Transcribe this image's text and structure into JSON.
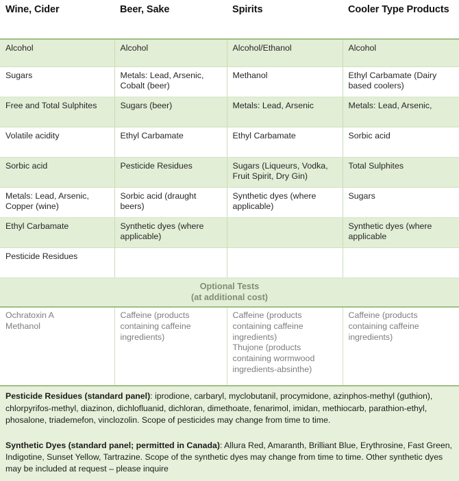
{
  "table": {
    "headers": [
      "Wine, Cider",
      "Beer, Sake",
      "Spirits",
      "Cooler Type Products"
    ],
    "rows": [
      [
        "Alcohol",
        "Alcohol",
        "Alcohol/Ethanol",
        "Alcohol"
      ],
      [
        "Sugars",
        "Metals: Lead, Arsenic, Cobalt (beer)",
        "Methanol",
        "Ethyl Carbamate (Dairy based coolers)"
      ],
      [
        "Free and Total Sulphites",
        "Sugars (beer)",
        "Metals: Lead, Arsenic",
        "Metals: Lead, Arsenic,"
      ],
      [
        "Volatile acidity",
        "Ethyl Carbamate",
        "Ethyl Carbamate",
        "Sorbic acid"
      ],
      [
        "Sorbic acid",
        "Pesticide Residues",
        "Sugars (Liqueurs, Vodka, Fruit Spirit, Dry Gin)",
        "Total Sulphites"
      ],
      [
        "Metals: Lead, Arsenic, Copper (wine)",
        "Sorbic acid (draught beers)",
        "Synthetic dyes (where applicable)",
        "Sugars"
      ],
      [
        "Ethyl Carbamate",
        "Synthetic dyes (where applicable)",
        "",
        "Synthetic dyes (where applicable"
      ],
      [
        "Pesticide Residues",
        "",
        "",
        ""
      ]
    ]
  },
  "optional": {
    "banner_line1": "Optional Tests",
    "banner_line2": "(at additional cost)",
    "cells": [
      "Ochratoxin A\nMethanol",
      "Caffeine (products containing caffeine ingredients)",
      "Caffeine (products containing caffeine ingredients)\nThujone (products containing wormwood ingredients-absinthe)",
      "Caffeine (products containing caffeine ingredients)"
    ]
  },
  "notes": [
    {
      "label": "Pesticide Residues (standard panel)",
      "text": ": iprodione, carbaryl, myclobutanil, procymidone, azinphos-methyl (guthion), chlorpyrifos-methyl, diazinon, dichlofluanid, dichloran, dimethoate, fenarimol, imidan, methiocarb, parathion-ethyl, phosalone, triademefon, vinclozolin. Scope of pesticides may change from time to time."
    },
    {
      "label": "Synthetic Dyes (standard panel; permitted in Canada)",
      "text": ": Allura Red, Amaranth, Brilliant Blue, Erythrosine, Fast Green, Indigotine, Sunset Yellow, Tartrazine. Scope of the synthetic dyes may change from time to time. Other synthetic dyes may be included at request – please inquire"
    }
  ],
  "colors": {
    "shade_green": "#e3eed6",
    "border_green": "#9cbf83",
    "note_bg": "#e6f0da",
    "optional_text": "#7d7d7d"
  }
}
